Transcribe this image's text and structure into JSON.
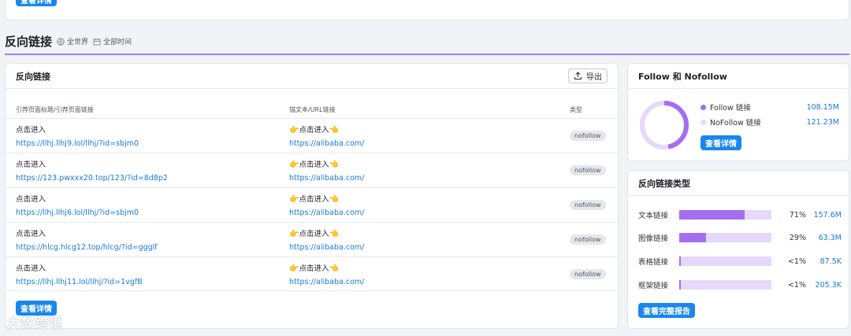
{
  "top": {
    "detail_button": "查看详情"
  },
  "section": {
    "title": "反向链接",
    "region": "全世界",
    "period": "全部时间"
  },
  "backlinks": {
    "title": "反向链接",
    "export_label": "导出",
    "columns": [
      "引荐页面标题/引荐页面链接",
      "锚文本/URL链接",
      "类型"
    ],
    "rows": [
      {
        "title": "点击进入",
        "url": "https://llhj.llhj9.lol/llhj/?id=sbjm0",
        "anchor": "点击进入",
        "target": "https://alibaba.com/",
        "type": "nofollow"
      },
      {
        "title": "点击进入",
        "url": "https://123.pwxxx20.top/123/?id=8d8p2",
        "anchor": "点击进入",
        "target": "https://alibaba.com/",
        "type": "nofollow"
      },
      {
        "title": "点击进入",
        "url": "https://llhj.llhj6.lol/llhj/?id=sbjm0",
        "anchor": "点击进入",
        "target": "https://alibaba.com/",
        "type": "nofollow"
      },
      {
        "title": "点击进入",
        "url": "https://hlcg.hlcg12.top/hlcg/?id=ggglf",
        "anchor": "点击进入",
        "target": "https://alibaba.com/",
        "type": "nofollow"
      },
      {
        "title": "点击进入",
        "url": "https://llhj.llhj11.lol/llhj/?id=1vgfB",
        "anchor": "点击进入",
        "target": "https://alibaba.com/",
        "type": "nofollow"
      }
    ],
    "detail_button": "查看详情"
  },
  "follow": {
    "title": "Follow 和 Nofollow",
    "items": [
      {
        "label": "Follow 链接",
        "value": "108.15M",
        "color": "#a56ef0"
      },
      {
        "label": "NoFollow 链接",
        "value": "121.23M",
        "color": "#e6d8fb"
      }
    ],
    "follow_fraction": 0.47,
    "detail_button": "查看详情"
  },
  "types": {
    "title": "反向链接类型",
    "rows": [
      {
        "label": "文本链接",
        "pct": "71%",
        "value": "157.6M",
        "fraction": 0.71
      },
      {
        "label": "图像链接",
        "pct": "29%",
        "value": "63.3M",
        "fraction": 0.29
      },
      {
        "label": "表格链接",
        "pct": "<1%",
        "value": "87.5K",
        "fraction": 0.01
      },
      {
        "label": "框架链接",
        "pct": "<1%",
        "value": "205.3K",
        "fraction": 0.01
      }
    ],
    "report_button": "查看完整报告"
  },
  "watermark": "大数跨境"
}
